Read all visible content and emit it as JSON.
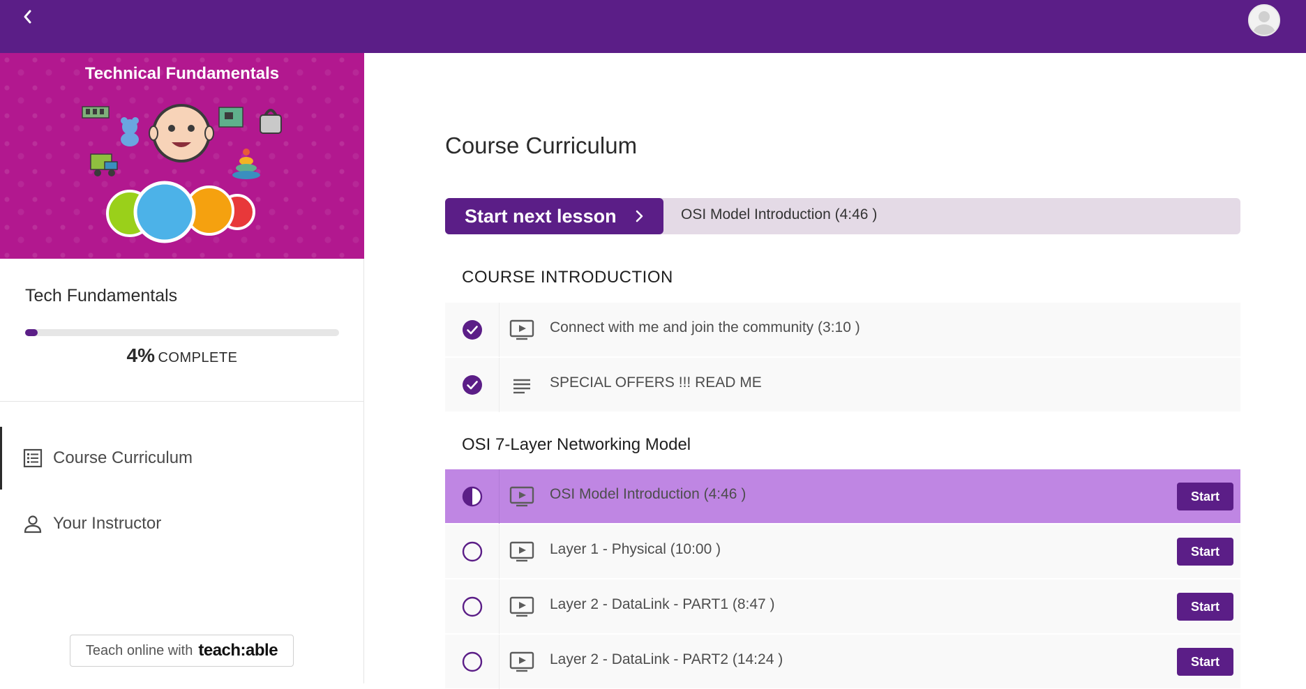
{
  "topbar": {
    "back_icon": "chevron-left-icon",
    "avatar_icon": "user-avatar-icon",
    "brand_color": "#5b1e87"
  },
  "sidebar": {
    "banner_title": "Technical Fundamentals",
    "course_title": "Tech Fundamentals",
    "progress": {
      "percent": 4,
      "percent_label": "4%",
      "complete_label": "COMPLETE"
    },
    "nav": [
      {
        "label": "Course Curriculum",
        "icon": "list-icon",
        "active": true
      },
      {
        "label": "Your Instructor",
        "icon": "person-icon",
        "active": false
      }
    ],
    "teach_link": {
      "text": "Teach online with",
      "logo": "teach:able"
    }
  },
  "main": {
    "page_title": "Course Curriculum",
    "next_lesson": {
      "button_label": "Start next lesson",
      "lesson_name": "OSI Model Introduction (4:46 )"
    },
    "sections": [
      {
        "title": "COURSE INTRODUCTION",
        "lessons": [
          {
            "title": "Connect with me and join the community (3:10 )",
            "type": "video",
            "status": "completed"
          },
          {
            "title": "SPECIAL OFFERS !!! READ ME",
            "type": "text",
            "status": "completed"
          }
        ]
      },
      {
        "title": "OSI 7-Layer Networking Model",
        "lessons": [
          {
            "title": "OSI Model Introduction (4:46 )",
            "type": "video",
            "status": "in-progress",
            "button": "Start"
          },
          {
            "title": "Layer 1 - Physical (10:00 )",
            "type": "video",
            "status": "not-started",
            "button": "Start"
          },
          {
            "title": "Layer 2 - DataLink - PART1 (8:47 )",
            "type": "video",
            "status": "not-started",
            "button": "Start"
          },
          {
            "title": "Layer 2 - DataLink - PART2 (14:24 )",
            "type": "video",
            "status": "not-started",
            "button": "Start"
          }
        ]
      }
    ]
  },
  "colors": {
    "accent": "#5b1e87",
    "current_row": "#bf86e3",
    "next_bar_bg": "#e4dae6"
  }
}
